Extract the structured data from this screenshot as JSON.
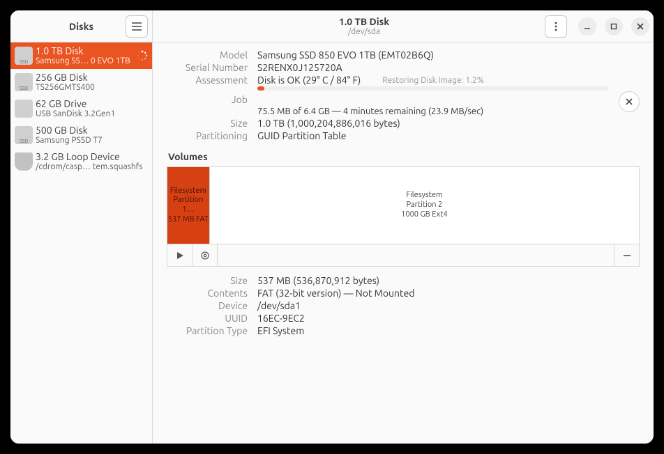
{
  "sidebar": {
    "title": "Disks",
    "items": [
      {
        "title": "1.0 TB Disk",
        "sub": "Samsung SS…  0 EVO 1TB",
        "iconLabel": "SSD",
        "iconKind": "ssd",
        "selected": true,
        "busy": true
      },
      {
        "title": "256 GB Disk",
        "sub": "TS256GMTS400",
        "iconLabel": "SSD",
        "iconKind": "ssd",
        "selected": false,
        "busy": false
      },
      {
        "title": "62 GB Drive",
        "sub": "USB SanDisk 3.2Gen1",
        "iconLabel": "",
        "iconKind": "usb",
        "selected": false,
        "busy": false
      },
      {
        "title": "500 GB Disk",
        "sub": "Samsung PSSD T7",
        "iconLabel": "SSD",
        "iconKind": "ssd",
        "selected": false,
        "busy": false
      },
      {
        "title": "3.2 GB Loop Device",
        "sub": "/cdrom/casp…  tem.squashfs",
        "iconLabel": "",
        "iconKind": "loop",
        "selected": false,
        "busy": false
      }
    ]
  },
  "header": {
    "title": "1.0 TB Disk",
    "subtitle": "/dev/sda"
  },
  "disk": {
    "model_label": "Model",
    "model": "Samsung SSD 850 EVO 1TB (EMT02B6Q)",
    "serial_label": "Serial Number",
    "serial": "S2RENX0J125720A",
    "assessment_label": "Assessment",
    "assessment": "Disk is OK (29° C / 84° F)",
    "job_label": "Job",
    "job_caption": "Restoring Disk Image: 1.2%",
    "job_progress_pct": 1.2,
    "job_status": "75.5 MB of 6.4 GB — 4 minutes remaining (23.9 MB/sec)",
    "size_label": "Size",
    "size": "1.0 TB (1,000,204,886,016 bytes)",
    "partitioning_label": "Partitioning",
    "partitioning": "GUID Partition Table"
  },
  "volumes": {
    "heading": "Volumes",
    "items": [
      {
        "title": "Filesystem",
        "sub1": "Partition 1…",
        "sub2": "537 MB FAT",
        "widthPct": 9,
        "selected": true
      },
      {
        "title": "Filesystem",
        "sub1": "Partition 2",
        "sub2": "1000 GB Ext4",
        "widthPct": 91,
        "selected": false
      }
    ]
  },
  "selected_volume": {
    "size_label": "Size",
    "size": "537 MB (536,870,912 bytes)",
    "contents_label": "Contents",
    "contents": "FAT (32-bit version) — Not Mounted",
    "device_label": "Device",
    "device": "/dev/sda1",
    "uuid_label": "UUID",
    "uuid": "16EC-9EC2",
    "ptype_label": "Partition Type",
    "ptype": "EFI System"
  }
}
